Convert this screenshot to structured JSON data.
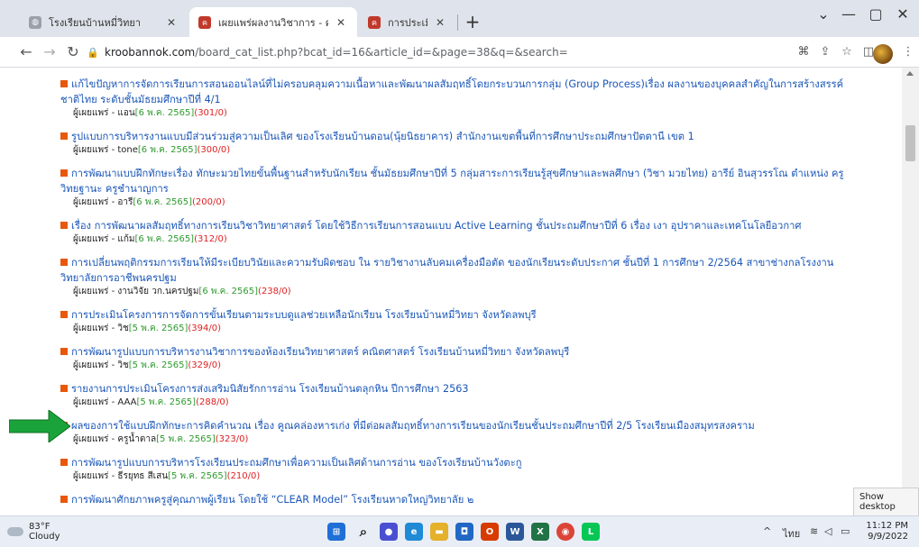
{
  "browser": {
    "tabs": [
      {
        "title": "โรงเรียนบ้านหมี่วิทยา",
        "favicon_color": "#6b7280",
        "icon": "globe-icon"
      },
      {
        "title": "เผยแพร่ผลงานวิชาการ - ครูบ้านนอกดอ",
        "favicon_color": "#c0392b",
        "icon": "site-favicon-icon"
      },
      {
        "title": "การประเมินโครงการการจัดการขั้นเรียน",
        "favicon_color": "#c0392b",
        "icon": "site-favicon-icon"
      }
    ],
    "address": {
      "host": "kroobannok.com",
      "path": "/board_cat_list.php?bcat_id=16&article_id=&page=38&q=&search="
    }
  },
  "items": [
    {
      "title": "แก้ไขปัญหาการจัดการเรียนการสอนออนไลน์ที่ไม่ครอบคลุมความเนื้อหาและพัฒนาผลสัมฤทธิ์โดยกระบวนการกลุ่ม (Group Process)เรื่อง ผลงานของบุคคลสำคัญในการสร้างสรรค์ชาติไทย ระดับชั้นมัธยมศึกษาปีที่ 4/1",
      "by": "ผู้เผยแพร่ - แอน",
      "date": "[6 พ.ค. 2565]",
      "count": "(301/0)"
    },
    {
      "title": "รูปแบบการบริหารงานแบบมีส่วนร่วมสู่ความเป็นเลิศ ของโรงเรียนบ้านดอน(นุ้ยนิธยาคาร) สำนักงานเขตพื้นที่การศึกษาประถมศึกษาปัตตานี เขต 1",
      "by": "ผู้เผยแพร่ - tone",
      "date": "[6 พ.ค. 2565]",
      "count": "(300/0)"
    },
    {
      "title": "การพัฒนาแบบฝึกทักษะเรื่อง ทักษะมวยไทยขั้นพื้นฐานสำหรับนักเรียน ชั้นมัธยมศึกษาปีที่ 5 กลุ่มสาระการเรียนรู้สุขศึกษาและพลศึกษา (วิชา มวยไทย) อารีย์ อินสุวรรโณ ตำแหน่ง ครู วิทยฐานะ ครูชำนาญการ",
      "by": "ผู้เผยแพร่ - อารี",
      "date": "[6 พ.ค. 2565]",
      "count": "(200/0)"
    },
    {
      "title": "เรื่อง การพัฒนาผลสัมฤทธิ์ทางการเรียนวิชาวิทยาศาสตร์ โดยใช้วิธีการเรียนการสอนแบบ Active Learning ชั้นประถมศึกษาปีที่ 6 เรื่อง เงา อุปราคาและเทคโนโลยีอวกาศ",
      "by": "ผู้เผยแพร่ - แก้ม",
      "date": "[6 พ.ค. 2565]",
      "count": "(312/0)"
    },
    {
      "title": "การเปลี่ยนพฤติกรรมการเรียนให้มีระเบียบวินัยและความรับผิดชอบ ใน รายวิชางานลับคมเครื่องมือตัด ของนักเรียนระดับประกาศ ชั้นปีที่ 1 การศึกษา 2/2564 สาขาช่างกลโรงงาน วิทยาลัยการอาชีพนครปฐม",
      "by": "ผู้เผยแพร่ - งานวิจัย วก.นครปฐม",
      "date": "[6 พ.ค. 2565]",
      "count": "(238/0)"
    },
    {
      "title": "การประเมินโครงการการจัดการขั้นเรียนตามระบบดูแลช่วยเหลือนักเรียน โรงเรียนบ้านหมี่วิทยา จังหวัดลพบุรี",
      "by": "ผู้เผยแพร่ - วิช",
      "date": "[5 พ.ค. 2565]",
      "count": "(394/0)"
    },
    {
      "title": "การพัฒนารูปแบบการบริหารงานวิชาการของห้องเรียนวิทยาศาสตร์ คณิตศาสตร์ โรงเรียนบ้านหมี่วิทยา จังหวัดลพบุรี",
      "by": "ผู้เผยแพร่ - วิช",
      "date": "[5 พ.ค. 2565]",
      "count": "(329/0)"
    },
    {
      "title": "รายงานการประเมินโครงการส่งเสริมนิสัยรักการอ่าน โรงเรียนบ้านตลุกหิน ปีการศึกษา 2563",
      "by": "ผู้เผยแพร่ - AAA",
      "date": "[5 พ.ค. 2565]",
      "count": "(288/0)"
    },
    {
      "title": "ผลของการใช้แบบฝึกทักษะการคิดคำนวณ เรื่อง คูณคล่องหารเก่ง ที่มีต่อผลสัมฤทธิ์ทางการเรียนของนักเรียนชั้นประถมศึกษาปีที่ 2/5 โรงเรียนเมืองสมุทรสงคราม",
      "by": "ผู้เผยแพร่ - ครูน้ำตาล",
      "date": "[5 พ.ค. 2565]",
      "count": "(323/0)"
    },
    {
      "title": "การพัฒนารูปแบบการบริหารโรงเรียนประถมศึกษาเพื่อความเป็นเลิศด้านการอ่าน ของโรงเรียนบ้านวังตะกู",
      "by": "ผู้เผยแพร่ - ธีรยุทธ สีเสน",
      "date": "[5 พ.ค. 2565]",
      "count": "(210/0)"
    },
    {
      "title": "การพัฒนาศักยภาพครูสู่คุณภาพผู้เรียน โดยใช้ “CLEAR Model” โรงเรียนหาดใหญ่วิทยาลัย ๒",
      "by": "",
      "date": "",
      "count": ""
    }
  ],
  "tooltip": "Show desktop",
  "taskbar": {
    "weather_temp": "83°F",
    "weather_desc": "Cloudy",
    "ime": "ไทย",
    "time": "11:12 PM",
    "date": "9/9/2022"
  },
  "colors": {
    "link": "#1a56b8",
    "date": "#2e9a2e",
    "count": "#d22222",
    "arrow": "#1aa33a",
    "bullet": "#e8580c"
  }
}
